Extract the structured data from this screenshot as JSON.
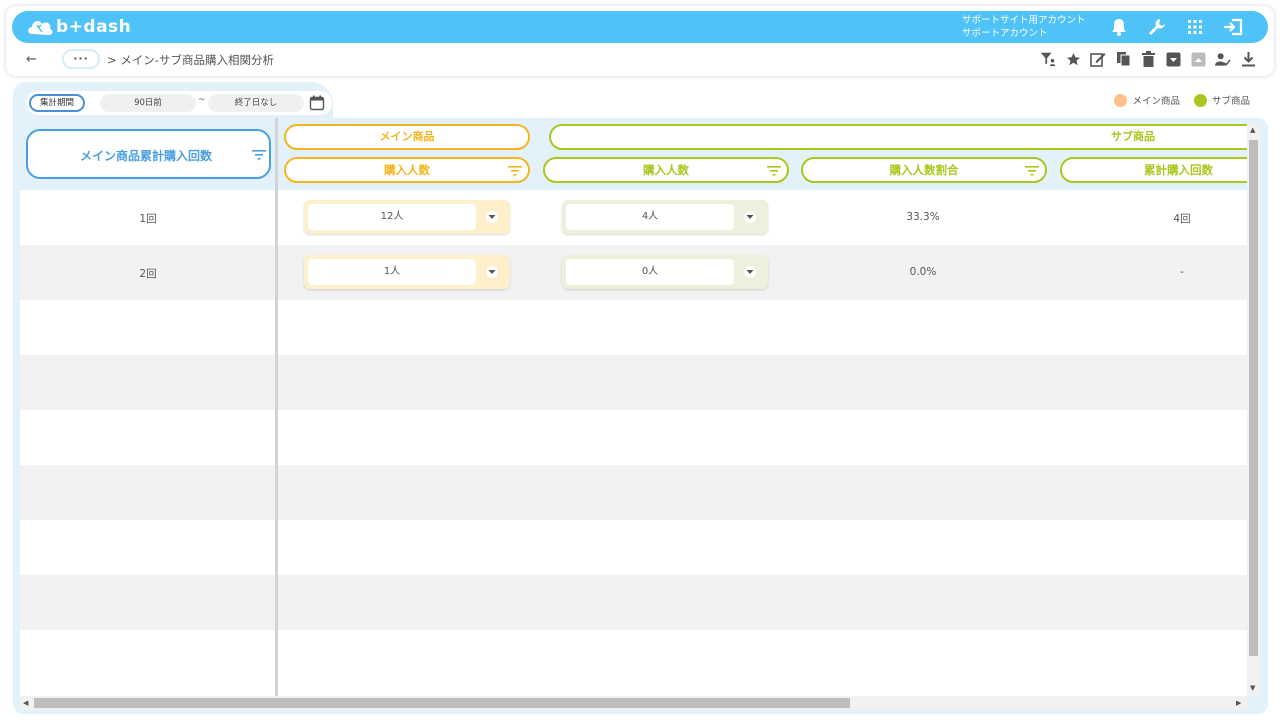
{
  "app": {
    "logo_text": "b+dash",
    "account_line1": "サポートサイト用アカウント",
    "account_line2": "サポートアカウント",
    "brand_color": "#4fc3f7"
  },
  "topbar_icons": [
    "bell-icon",
    "wrench-icon",
    "apps-grid-icon",
    "logout-icon"
  ],
  "subbar": {
    "back": "←",
    "more": "···",
    "breadcrumb": "> メイン-サブ商品購入相関分析",
    "tools": [
      "filter-user-icon",
      "star-icon",
      "edit-icon",
      "copy-icon",
      "trash-icon",
      "archive-icon",
      "unarchive-icon",
      "user-check-icon",
      "download-icon"
    ]
  },
  "period": {
    "label": "集計期間",
    "start": "90日前",
    "separator": "~",
    "end": "終了日なし"
  },
  "legend": {
    "main": {
      "label": "メイン商品",
      "color": "#ffbf8a"
    },
    "sub": {
      "label": "サブ商品",
      "color": "#a8c81e"
    }
  },
  "table": {
    "row_header": "メイン商品累計購入回数",
    "groups": {
      "main": "メイン商品",
      "sub": "サブ商品"
    },
    "columns": {
      "main_buyers": "購入人数",
      "sub_buyers": "購入人数",
      "sub_ratio": "購入人数割合",
      "sub_cum_count": "累計購入回数"
    },
    "rows": [
      {
        "count": "1回",
        "main_buyers": "12人",
        "sub_buyers": "4人",
        "ratio": "33.3%",
        "cum": "4回"
      },
      {
        "count": "2回",
        "main_buyers": "1人",
        "sub_buyers": "0人",
        "ratio": "0.0%",
        "cum": "-"
      }
    ]
  },
  "colors": {
    "main_accent": "#f5b51e",
    "sub_accent": "#a8c81e",
    "row_header_accent": "#4a9fe3"
  }
}
